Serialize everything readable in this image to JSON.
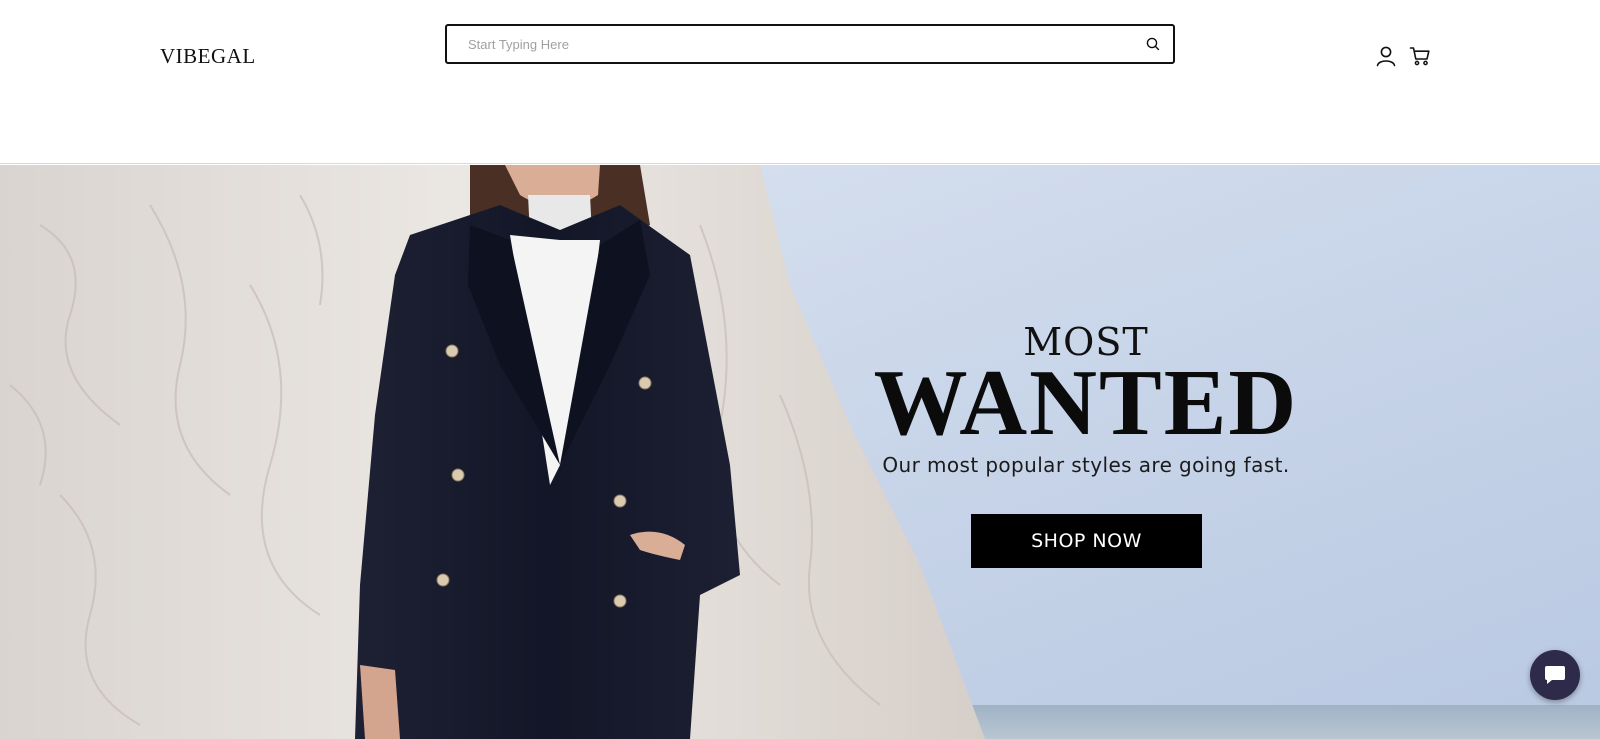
{
  "header": {
    "logo_text": "VIBEGAL",
    "search": {
      "placeholder": "Start Typing Here",
      "value": ""
    },
    "icons": {
      "search": "search-icon",
      "account": "user-icon",
      "cart": "cart-icon"
    }
  },
  "hero": {
    "heading_small": "MOST",
    "heading_large": "WANTED",
    "subtitle": "Our most popular styles are going fast.",
    "cta_label": "SHOP NOW"
  },
  "chat": {
    "icon": "chat-bubble-icon"
  },
  "colors": {
    "brand_black": "#000000",
    "chat_bg": "#2e2a4a",
    "sky": "#c9d6ea",
    "cliff": "#e6e1dc",
    "coat": "#15192b"
  }
}
